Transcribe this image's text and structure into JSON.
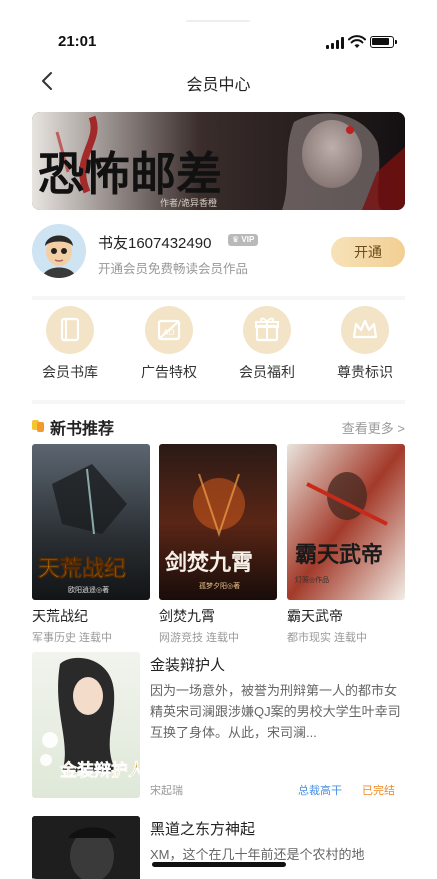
{
  "status_bar": {
    "time": "21:01"
  },
  "nav": {
    "title": "会员中心",
    "back_icon": "chevron-left-icon"
  },
  "banner": {
    "title": "恐怖邮差",
    "subtitle": "作者/诡异香橙"
  },
  "user": {
    "name": "书友1607432490",
    "vip_label": "VIP",
    "subtitle": "开通会员免费畅读会员作品",
    "open_button": "开通"
  },
  "features": [
    {
      "label": "会员书库",
      "icon": "book-icon"
    },
    {
      "label": "广告特权",
      "icon": "no-ad-icon"
    },
    {
      "label": "会员福利",
      "icon": "gift-icon"
    },
    {
      "label": "尊贵标识",
      "icon": "crown-icon"
    }
  ],
  "new_books": {
    "title": "新书推荐",
    "more": "查看更多 >",
    "items": [
      {
        "title": "天荒战纪",
        "meta": "军事历史 连载中",
        "cover_text": "天荒战纪",
        "cover_author": "欧阳逍遥◎著"
      },
      {
        "title": "剑焚九霄",
        "meta": "网游竞技 连载中",
        "cover_text": "剑焚九霄",
        "cover_author": "孤梦夕阳◎著"
      },
      {
        "title": "霸天武帝",
        "meta": "都市现实 连载中",
        "cover_text": "霸天武帝",
        "cover_author": "灯笼◎作品"
      }
    ]
  },
  "featured_book": {
    "title": "金装辩护人",
    "description": "因为一场意外，被誉为刑辩第一人的都市女精英宋司澜跟涉嫌QJ案的男校大学生叶幸司互换了身体。从此，宋司澜...",
    "author": "宋起瑞",
    "tag_total": "总裁高干",
    "tag_status": "已完结",
    "cover_text": "金装辩护人"
  },
  "next_book": {
    "title": "黑道之东方神起",
    "description": "XM，这个在几十年前还是个农村的地"
  },
  "colors": {
    "accent_gold": "#f1cf93",
    "icon_bg": "#f3e4c8",
    "link_blue": "#4a90e2",
    "status_orange": "#f08a24"
  }
}
